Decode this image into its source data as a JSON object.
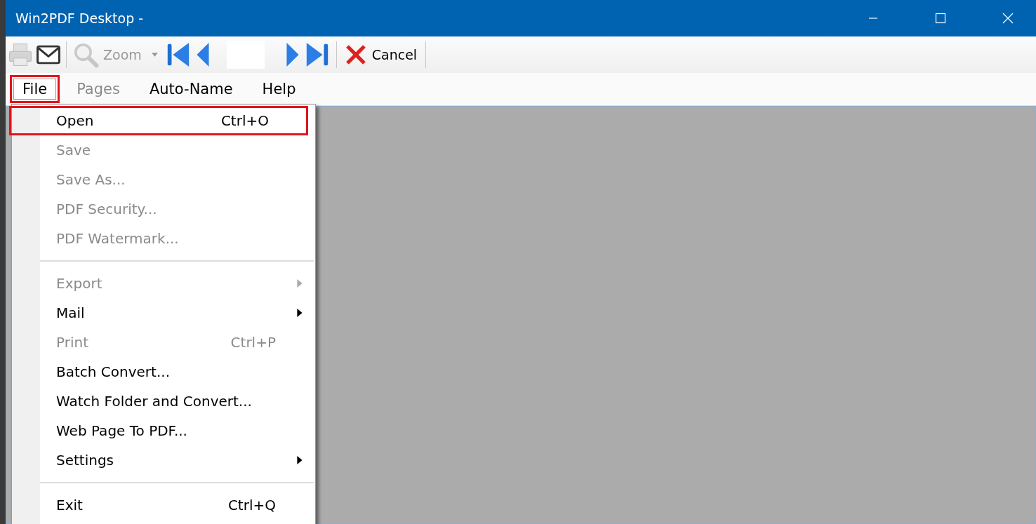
{
  "window": {
    "title": "Win2PDF Desktop -"
  },
  "toolbar": {
    "zoom": {
      "label": "Zoom",
      "disabled": true
    },
    "print_disabled": true,
    "cancel": {
      "label": "Cancel"
    }
  },
  "menubar": [
    {
      "label": "File",
      "disabled": false,
      "selected": true,
      "highlighted": true
    },
    {
      "label": "Pages",
      "disabled": true,
      "selected": false,
      "highlighted": false
    },
    {
      "label": "Auto-Name",
      "disabled": false,
      "selected": false,
      "highlighted": false
    },
    {
      "label": "Help",
      "disabled": false,
      "selected": false,
      "highlighted": false
    }
  ],
  "file_menu": [
    {
      "kind": "item",
      "label": "Open",
      "shortcut": "Ctrl+O",
      "disabled": false,
      "submenu": false,
      "highlighted": true
    },
    {
      "kind": "item",
      "label": "Save",
      "disabled": true,
      "submenu": false,
      "highlighted": false
    },
    {
      "kind": "item",
      "label": "Save As...",
      "disabled": true,
      "submenu": false,
      "highlighted": false
    },
    {
      "kind": "item",
      "label": "PDF Security...",
      "disabled": true,
      "submenu": false,
      "highlighted": false
    },
    {
      "kind": "item",
      "label": "PDF Watermark...",
      "disabled": true,
      "submenu": false,
      "highlighted": false
    },
    {
      "kind": "separator"
    },
    {
      "kind": "item",
      "label": "Export",
      "disabled": true,
      "submenu": true,
      "highlighted": false
    },
    {
      "kind": "item",
      "label": "Mail",
      "disabled": false,
      "submenu": true,
      "highlighted": false
    },
    {
      "kind": "item",
      "label": "Print",
      "shortcut": "Ctrl+P",
      "disabled": true,
      "submenu": false,
      "highlighted": false
    },
    {
      "kind": "item",
      "label": "Batch Convert...",
      "disabled": false,
      "submenu": false,
      "highlighted": false
    },
    {
      "kind": "item",
      "label": "Watch Folder and Convert...",
      "disabled": false,
      "submenu": false,
      "highlighted": false
    },
    {
      "kind": "item",
      "label": "Web Page To PDF...",
      "disabled": false,
      "submenu": false,
      "highlighted": false
    },
    {
      "kind": "item",
      "label": "Settings",
      "disabled": false,
      "submenu": true,
      "highlighted": false
    },
    {
      "kind": "separator"
    },
    {
      "kind": "item",
      "label": "Exit",
      "shortcut": "Ctrl+Q",
      "disabled": false,
      "submenu": false,
      "highlighted": false
    }
  ]
}
